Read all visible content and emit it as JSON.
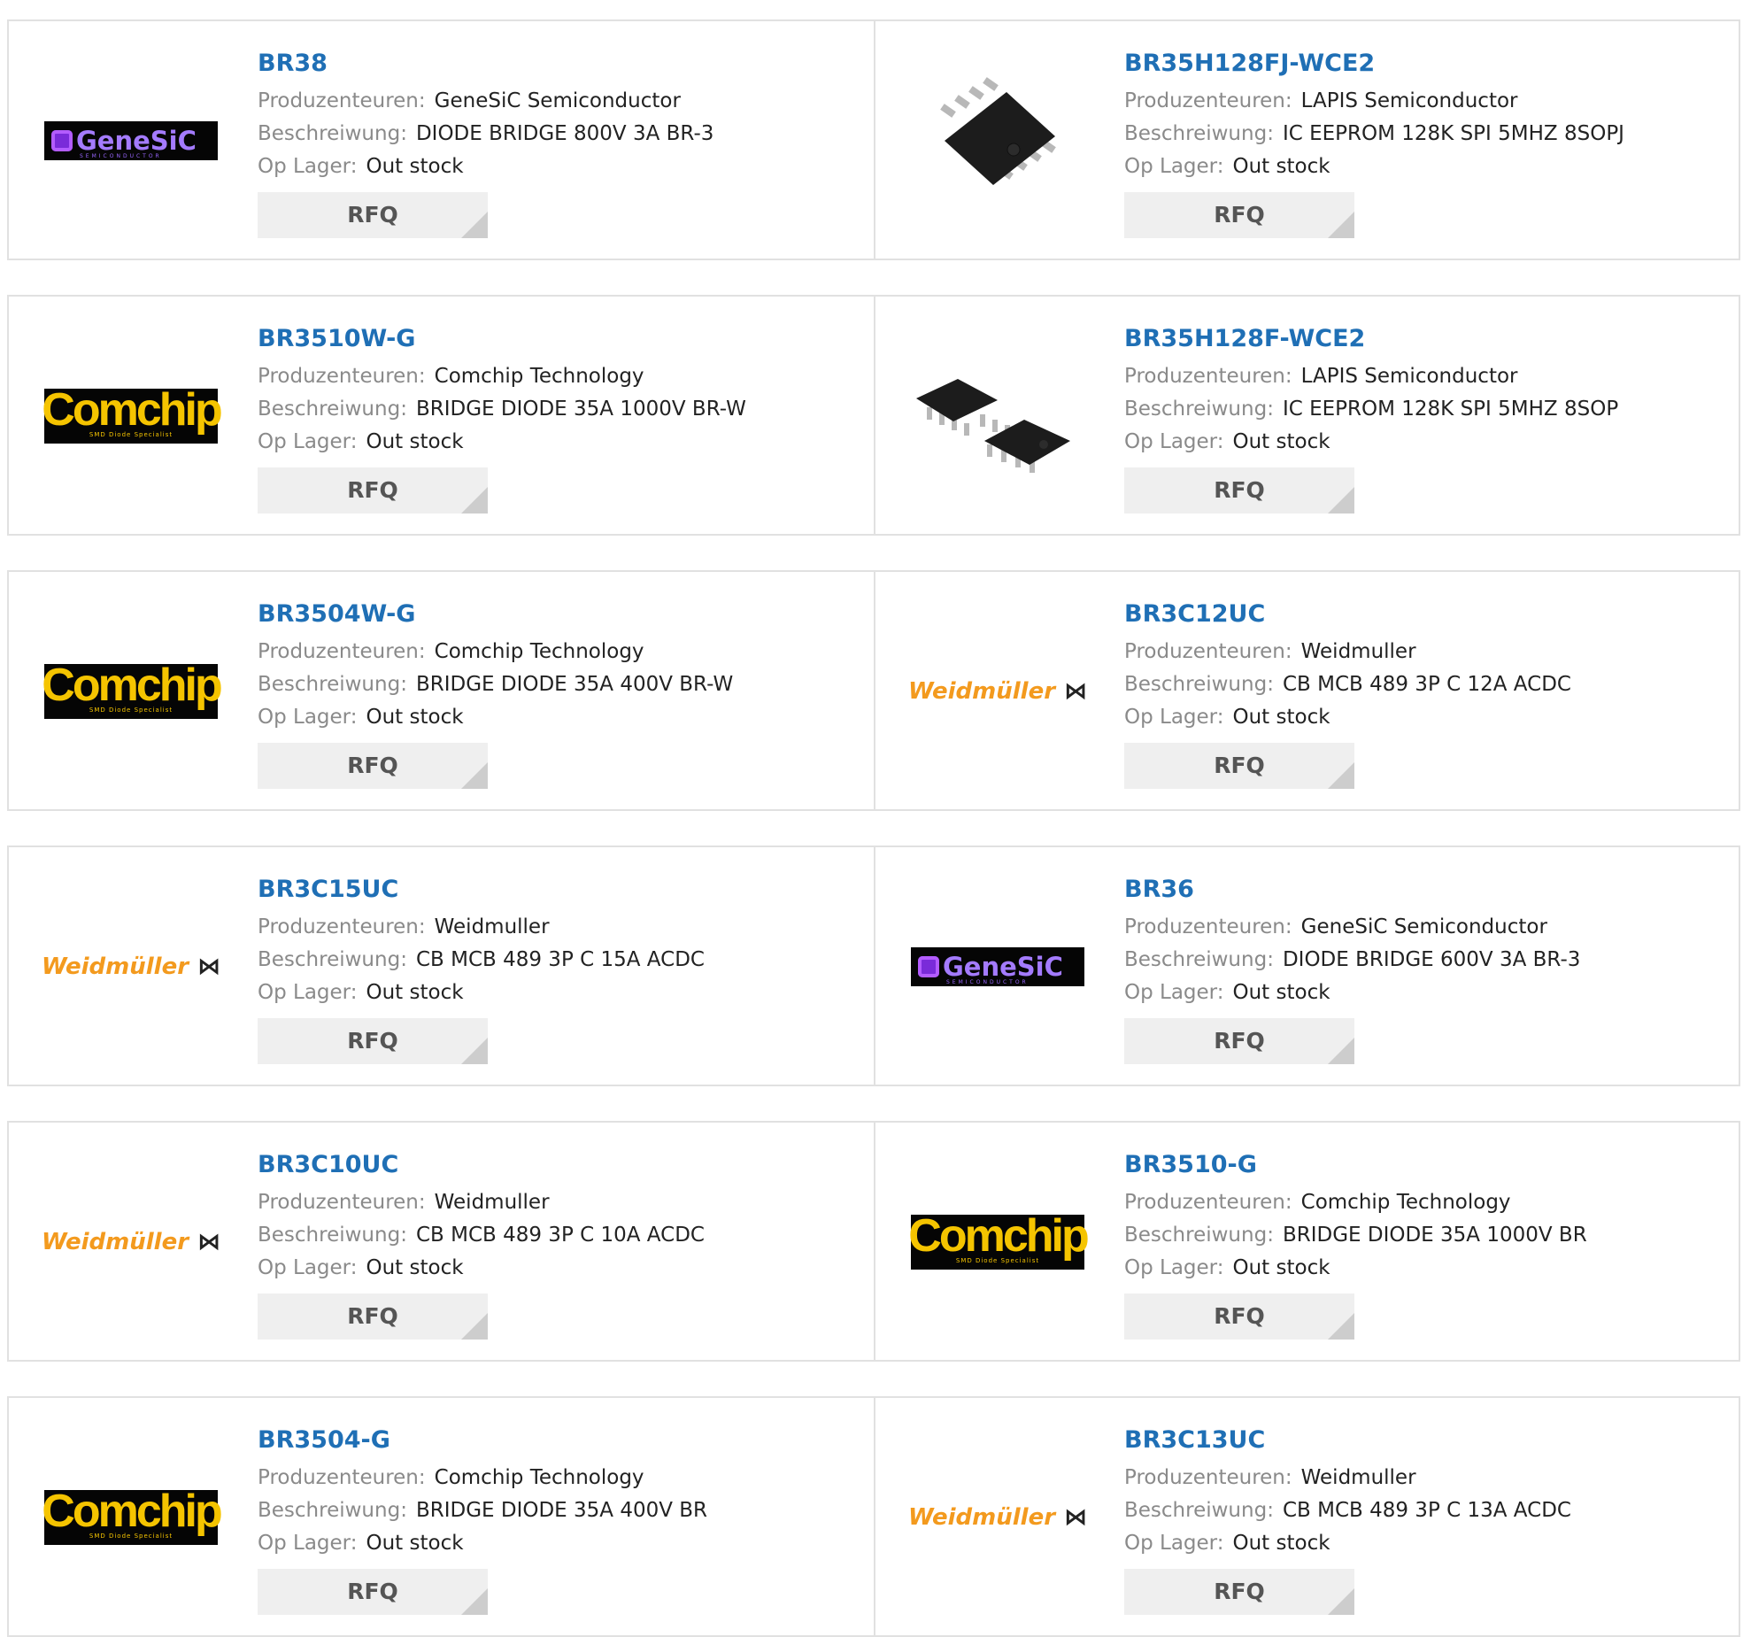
{
  "labels": {
    "manufacturer": "Produzenteuren:",
    "description": "Beschreiwung:",
    "stock": "Op Lager:",
    "rfq": "RFQ"
  },
  "logos": {
    "genesic": {
      "text": "GeneSiC",
      "sub": "SEMICONDUCTOR"
    },
    "comchip": {
      "text": "Comchip",
      "sub": "SMD Diode Specialist"
    },
    "weidmuller": {
      "text": "Weidmüller"
    }
  },
  "colors": {
    "part_link": "#1f6fb5",
    "label": "#8a8a8a",
    "value": "#222222",
    "border": "#e1e1e1",
    "rfq_bg": "#efefef",
    "comchip_yellow": "#f5c400",
    "weidmuller_orange": "#f39a1e",
    "genesic_purple": "#a47bff"
  },
  "rows": [
    {
      "left": {
        "part": "BR38",
        "manufacturer": "GeneSiC Semiconductor",
        "description": "DIODE BRIDGE 800V 3A BR-3",
        "stock": "Out stock",
        "logo": "genesic"
      },
      "right": {
        "part": "BR35H128FJ-WCE2",
        "manufacturer": "LAPIS Semiconductor",
        "description": "IC EEPROM 128K SPI 5MHZ 8SOPJ",
        "stock": "Out stock",
        "logo": "chip-single"
      }
    },
    {
      "left": {
        "part": "BR3510W-G",
        "manufacturer": "Comchip Technology",
        "description": "BRIDGE DIODE 35A 1000V BR-W",
        "stock": "Out stock",
        "logo": "comchip"
      },
      "right": {
        "part": "BR35H128F-WCE2",
        "manufacturer": "LAPIS Semiconductor",
        "description": "IC EEPROM 128K SPI 5MHZ 8SOP",
        "stock": "Out stock",
        "logo": "chip-double"
      }
    },
    {
      "left": {
        "part": "BR3504W-G",
        "manufacturer": "Comchip Technology",
        "description": "BRIDGE DIODE 35A 400V BR-W",
        "stock": "Out stock",
        "logo": "comchip"
      },
      "right": {
        "part": "BR3C12UC",
        "manufacturer": "Weidmuller",
        "description": "CB MCB 489 3P C 12A ACDC",
        "stock": "Out stock",
        "logo": "weidmuller"
      }
    },
    {
      "left": {
        "part": "BR3C15UC",
        "manufacturer": "Weidmuller",
        "description": "CB MCB 489 3P C 15A ACDC",
        "stock": "Out stock",
        "logo": "weidmuller"
      },
      "right": {
        "part": "BR36",
        "manufacturer": "GeneSiC Semiconductor",
        "description": "DIODE BRIDGE 600V 3A BR-3",
        "stock": "Out stock",
        "logo": "genesic"
      }
    },
    {
      "left": {
        "part": "BR3C10UC",
        "manufacturer": "Weidmuller",
        "description": "CB MCB 489 3P C 10A ACDC",
        "stock": "Out stock",
        "logo": "weidmuller"
      },
      "right": {
        "part": "BR3510-G",
        "manufacturer": "Comchip Technology",
        "description": "BRIDGE DIODE 35A 1000V BR",
        "stock": "Out stock",
        "logo": "comchip"
      }
    },
    {
      "left": {
        "part": "BR3504-G",
        "manufacturer": "Comchip Technology",
        "description": "BRIDGE DIODE 35A 400V BR",
        "stock": "Out stock",
        "logo": "comchip"
      },
      "right": {
        "part": "BR3C13UC",
        "manufacturer": "Weidmuller",
        "description": "CB MCB 489 3P C 13A ACDC",
        "stock": "Out stock",
        "logo": "weidmuller"
      }
    }
  ]
}
